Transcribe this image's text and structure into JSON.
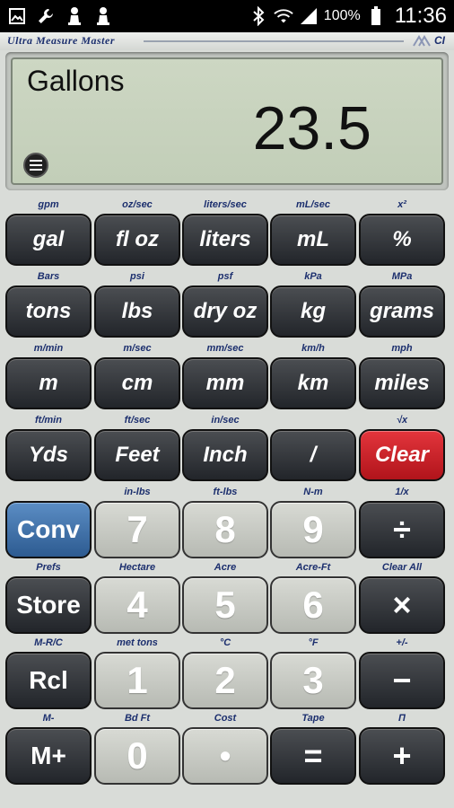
{
  "status_bar": {
    "battery_percent": "100%",
    "time": "11:36",
    "left_icons": [
      "image-icon",
      "wrench-icon",
      "chess-pawn-icon",
      "chess-pawn-icon"
    ]
  },
  "header": {
    "app_title": "Ultra Measure Master",
    "logo_text": "CI"
  },
  "display": {
    "unit": "Gallons",
    "value": "23.5"
  },
  "keys": [
    {
      "sub": "gpm",
      "label": "gal",
      "style": "dark"
    },
    {
      "sub": "oz/sec",
      "label": "fl oz",
      "style": "dark"
    },
    {
      "sub": "liters/sec",
      "label": "liters",
      "style": "dark"
    },
    {
      "sub": "mL/sec",
      "label": "mL",
      "style": "dark"
    },
    {
      "sub": "x²",
      "label": "%",
      "style": "dark"
    },
    {
      "sub": "Bars",
      "label": "tons",
      "style": "dark"
    },
    {
      "sub": "psi",
      "label": "lbs",
      "style": "dark"
    },
    {
      "sub": "psf",
      "label": "dry oz",
      "style": "dark"
    },
    {
      "sub": "kPa",
      "label": "kg",
      "style": "dark"
    },
    {
      "sub": "MPa",
      "label": "grams",
      "style": "dark"
    },
    {
      "sub": "m/min",
      "label": "m",
      "style": "dark"
    },
    {
      "sub": "m/sec",
      "label": "cm",
      "style": "dark"
    },
    {
      "sub": "mm/sec",
      "label": "mm",
      "style": "dark"
    },
    {
      "sub": "km/h",
      "label": "km",
      "style": "dark"
    },
    {
      "sub": "mph",
      "label": "miles",
      "style": "dark"
    },
    {
      "sub": "ft/min",
      "label": "Yds",
      "style": "dark"
    },
    {
      "sub": "ft/sec",
      "label": "Feet",
      "style": "dark"
    },
    {
      "sub": "in/sec",
      "label": "Inch",
      "style": "dark"
    },
    {
      "sub": "",
      "label": "/",
      "style": "dark"
    },
    {
      "sub": "√x",
      "label": "Clear",
      "style": "red"
    },
    {
      "sub": "",
      "label": "Conv",
      "style": "blue"
    },
    {
      "sub": "in-lbs",
      "label": "7",
      "style": "light"
    },
    {
      "sub": "ft-lbs",
      "label": "8",
      "style": "light"
    },
    {
      "sub": "N-m",
      "label": "9",
      "style": "light"
    },
    {
      "sub": "1/x",
      "label": "÷",
      "style": "dark"
    },
    {
      "sub": "Prefs",
      "label": "Store",
      "style": "dark"
    },
    {
      "sub": "Hectare",
      "label": "4",
      "style": "light"
    },
    {
      "sub": "Acre",
      "label": "5",
      "style": "light"
    },
    {
      "sub": "Acre-Ft",
      "label": "6",
      "style": "light"
    },
    {
      "sub": "Clear All",
      "label": "×",
      "style": "dark"
    },
    {
      "sub": "M-R/C",
      "label": "Rcl",
      "style": "dark"
    },
    {
      "sub": "met tons",
      "label": "1",
      "style": "light"
    },
    {
      "sub": "°C",
      "label": "2",
      "style": "light"
    },
    {
      "sub": "°F",
      "label": "3",
      "style": "light"
    },
    {
      "sub": "+/-",
      "label": "−",
      "style": "dark"
    },
    {
      "sub": "M-",
      "label": "M+",
      "style": "dark"
    },
    {
      "sub": "Bd Ft",
      "label": "0",
      "style": "light"
    },
    {
      "sub": "Cost",
      "label": "•",
      "style": "light"
    },
    {
      "sub": "Tape",
      "label": "=",
      "style": "dark"
    },
    {
      "sub": "Π",
      "label": "+",
      "style": "dark"
    }
  ]
}
